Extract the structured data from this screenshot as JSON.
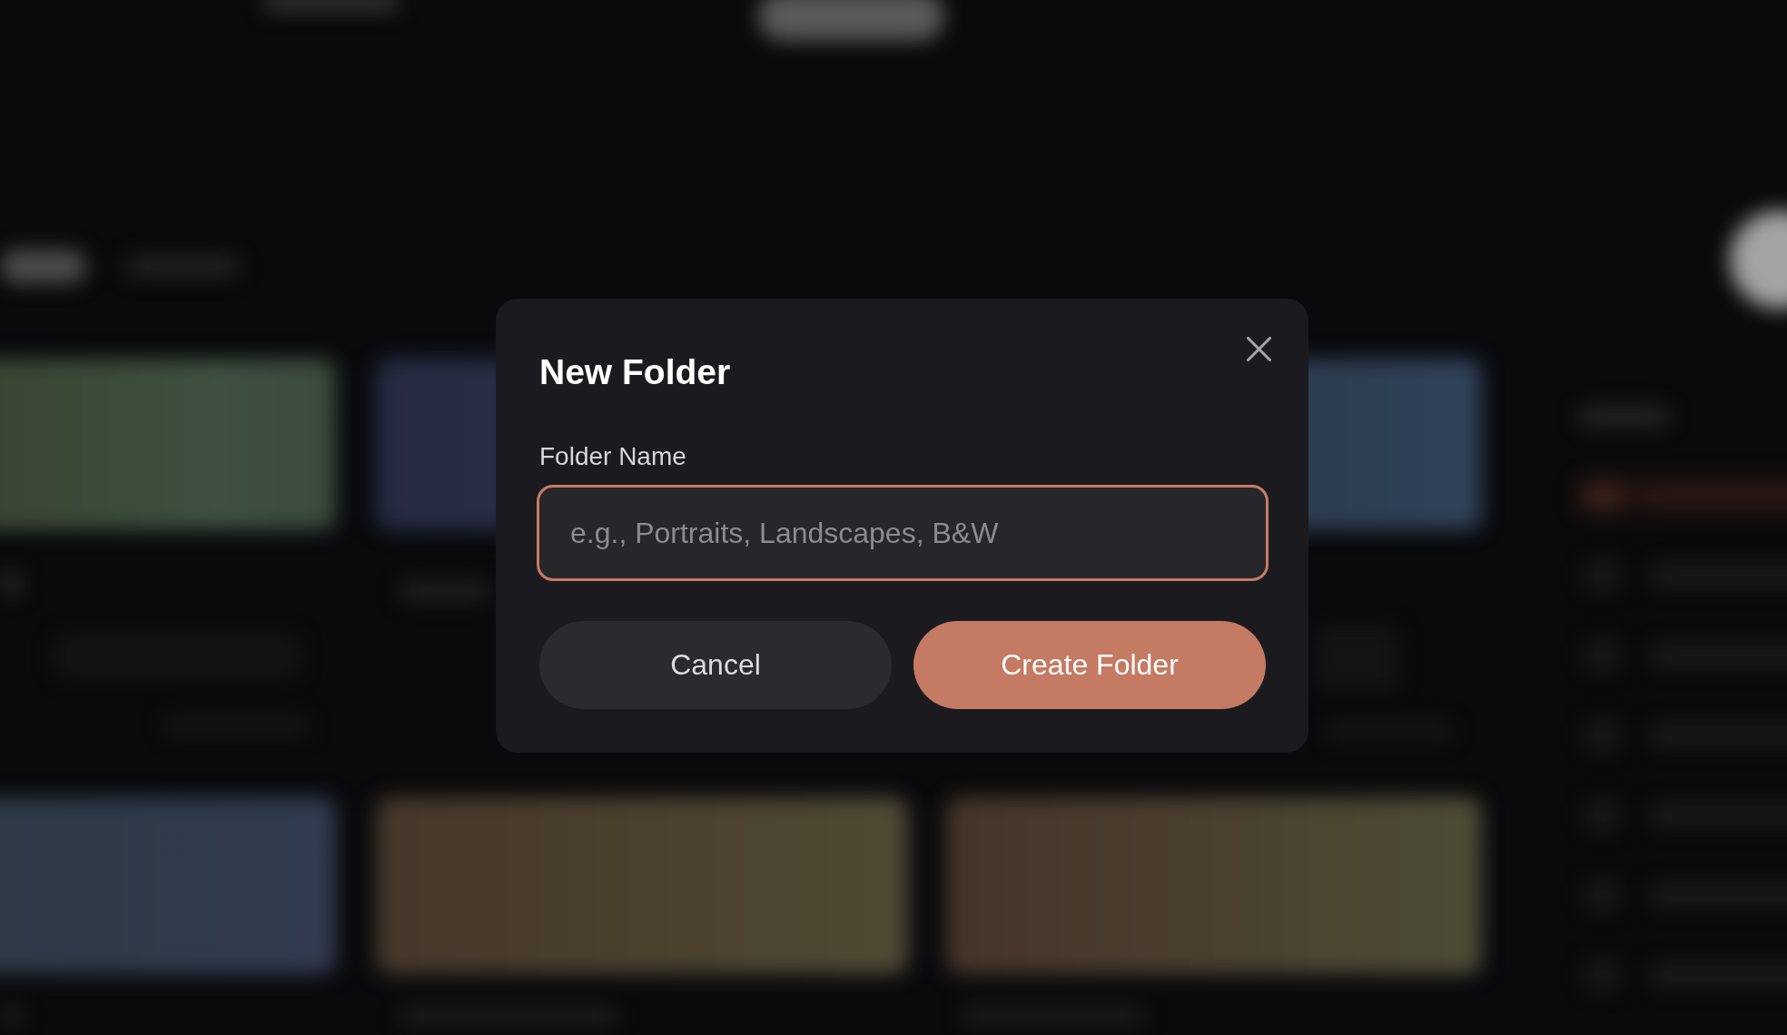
{
  "dialog": {
    "title": "New Folder",
    "field": {
      "label": "Folder Name",
      "placeholder": "e.g., Portraits, Landscapes, B&W",
      "focused": true
    },
    "buttons": [
      {
        "label": "Cancel",
        "kind": "cancel"
      },
      {
        "label": "Create Folder",
        "kind": "confirm"
      }
    ]
  }
}
